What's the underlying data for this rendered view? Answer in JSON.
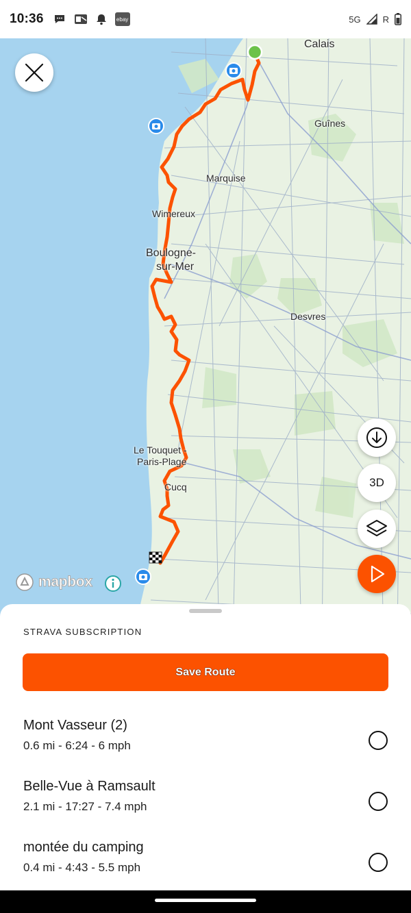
{
  "status_bar": {
    "time": "10:36",
    "ebay_badge": "ebay",
    "network": "5G",
    "roaming": "R",
    "icons_left": [
      "chat-bubble-icon",
      "outlook-icon",
      "notification-bell-icon",
      "ebay-icon"
    ],
    "icons_right": [
      "signal-icon",
      "battery-icon"
    ]
  },
  "map": {
    "attribution": "mapbox",
    "places": {
      "calais": "Calais",
      "guines": "Guînes",
      "marquise": "Marquise",
      "wimereux": "Wimereux",
      "boulogne": "Boulogne-\nsur-Mer",
      "boulogne_line1": "Boulogne-",
      "boulogne_line2": "sur-Mer",
      "desvres": "Desvres",
      "letouquet_line1": "Le Touquet -",
      "letouquet_line2": "Paris-Plage",
      "cucq": "Cucq"
    },
    "route_color": "#fc5200",
    "start_color": "#6cc24a",
    "water_color": "#a6d3ef",
    "land_color": "#e9f2e3"
  },
  "controls": {
    "close_icon": "close-icon",
    "download_icon": "download-icon",
    "three_d_label": "3D",
    "layers_icon": "layers-icon",
    "play_icon": "play-icon"
  },
  "sheet": {
    "subscription_label": "STRAVA SUBSCRIPTION",
    "save_button": "Save Route",
    "segments": [
      {
        "name": "Mont Vasseur (2)",
        "meta": "0.6 mi - 6:24 - 6 mph"
      },
      {
        "name": "Belle-Vue à Ramsault",
        "meta": "2.1 mi - 17:27 - 7.4 mph"
      },
      {
        "name": "montée du camping",
        "meta": "0.4 mi - 4:43 - 5.5 mph"
      }
    ]
  }
}
